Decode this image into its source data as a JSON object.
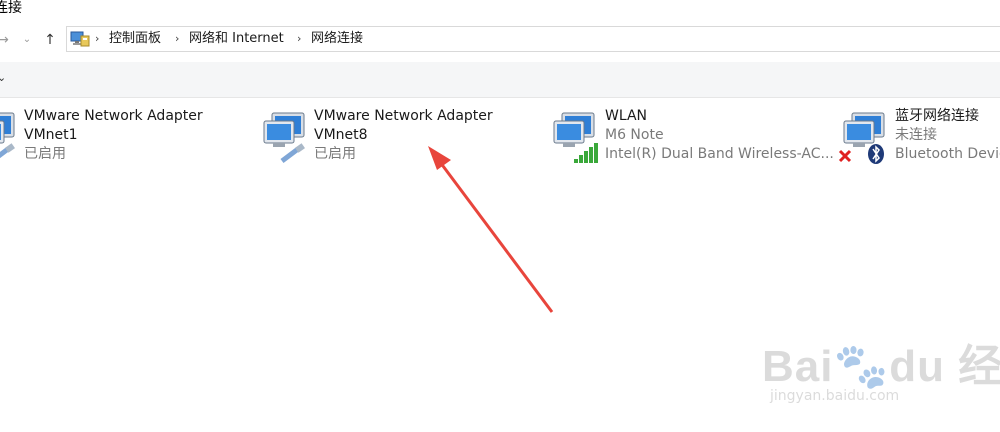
{
  "window": {
    "title": "连接"
  },
  "address_bar": {
    "breadcrumbs": [
      "控制面板",
      "网络和 Internet",
      "网络连接"
    ],
    "separator": "›"
  },
  "nav": {
    "back": "→",
    "dropdown": "⌄",
    "up": "↑"
  },
  "adapters": [
    {
      "name": "VMware Network Adapter",
      "line2": "VMnet1",
      "status": "已启用",
      "status_icon": "ethernet-cable-icon"
    },
    {
      "name": "VMware Network Adapter",
      "line2": "VMnet8",
      "status": "已启用",
      "status_icon": "ethernet-cable-icon"
    },
    {
      "name": "WLAN",
      "line2": "M6 Note",
      "status": "Intel(R) Dual Band Wireless-AC...",
      "status_icon": "wifi-signal-icon"
    },
    {
      "name": "蓝牙网络连接",
      "line2": "未连接",
      "status": "Bluetooth Device",
      "status_icon": "bluetooth-icon"
    }
  ],
  "watermark": {
    "brand": "Bai",
    "sub": "jingyan.baidu.com"
  },
  "colors": {
    "arrow": "#e8453c",
    "monitor_screen": "#2f7fd6",
    "disabled_x": "#e02020",
    "bluetooth": "#1f3a78"
  }
}
